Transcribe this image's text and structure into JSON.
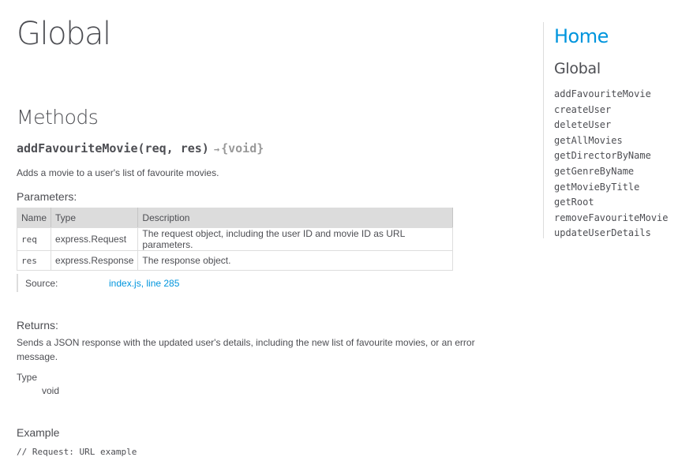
{
  "page": {
    "title": "Global"
  },
  "methods_section": {
    "heading": "Methods",
    "method": {
      "name": "addFavouriteMovie",
      "params_signature": "(req, res)",
      "arrow": "→",
      "return_type": "{void}",
      "description": "Adds a movie to a user's list of favourite movies.",
      "parameters_heading": "Parameters:",
      "table": {
        "headers": [
          "Name",
          "Type",
          "Description"
        ],
        "rows": [
          [
            "req",
            "express.Request",
            "The request object, including the user ID and movie ID as URL parameters."
          ],
          [
            "res",
            "express.Response",
            "The response object."
          ]
        ]
      },
      "source": {
        "label": "Source:",
        "file": "index.js",
        "separator": ", ",
        "line": "line 285"
      },
      "returns_heading": "Returns:",
      "returns_text": "Sends a JSON response with the updated user's details, including the new list of favourite movies, or an error message.",
      "type_label": "Type",
      "type_value": "void",
      "example_heading": "Example",
      "example_code": "// Request: URL example"
    }
  },
  "nav": {
    "home": "Home",
    "global": "Global",
    "items": [
      "addFavouriteMovie",
      "createUser",
      "deleteUser",
      "getAllMovies",
      "getDirectorByName",
      "getGenreByName",
      "getMovieByTitle",
      "getRoot",
      "removeFavouriteMovie",
      "updateUserDetails"
    ]
  },
  "colors": {
    "link": "#0095dd",
    "text": "#4d4e53",
    "table_header": "#dcdcdc"
  }
}
